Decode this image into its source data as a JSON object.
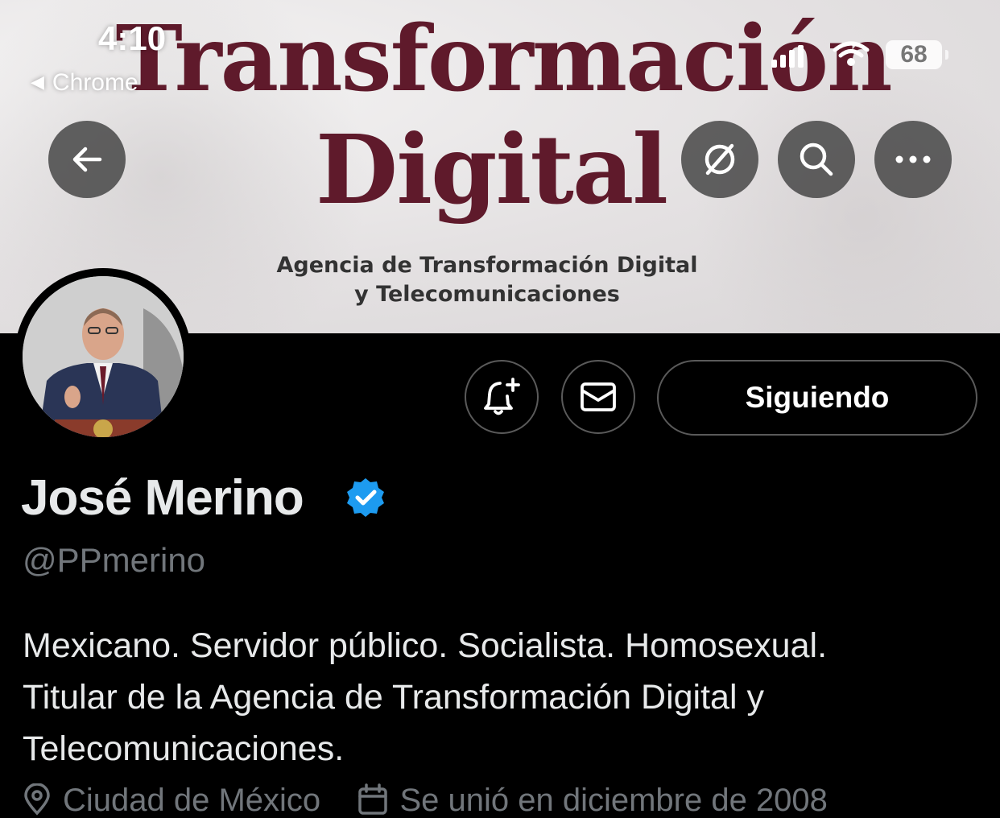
{
  "status_bar": {
    "time": "4:10",
    "back_app": "Chrome",
    "battery": "68"
  },
  "banner": {
    "line1": "Transformación",
    "line2": "Digital",
    "agency_line1": "Agencia de Transformación Digital",
    "agency_line2": "y Telecomunicaciones",
    "title_color": "#5f1a2b"
  },
  "toolbar": {
    "back_icon": "arrow-left-icon",
    "grok_icon": "slash-circle-icon",
    "search_icon": "search-icon",
    "more_icon": "more-horizontal-icon"
  },
  "actions": {
    "notify_icon": "bell-plus-icon",
    "message_icon": "envelope-icon",
    "follow_label": "Siguiendo"
  },
  "profile": {
    "name": "José Merino",
    "verified_color": "#1d9bf0",
    "handle": "@PPmerino",
    "bio_line1": "Mexicano. Servidor público. Socialista. Homosexual.",
    "bio_line2": "Titular de la Agencia de Transformación Digital y",
    "bio_line3": "Telecomunicaciones.",
    "location": "Ciudad de México",
    "joined": "Se unió en diciembre de 2008"
  }
}
